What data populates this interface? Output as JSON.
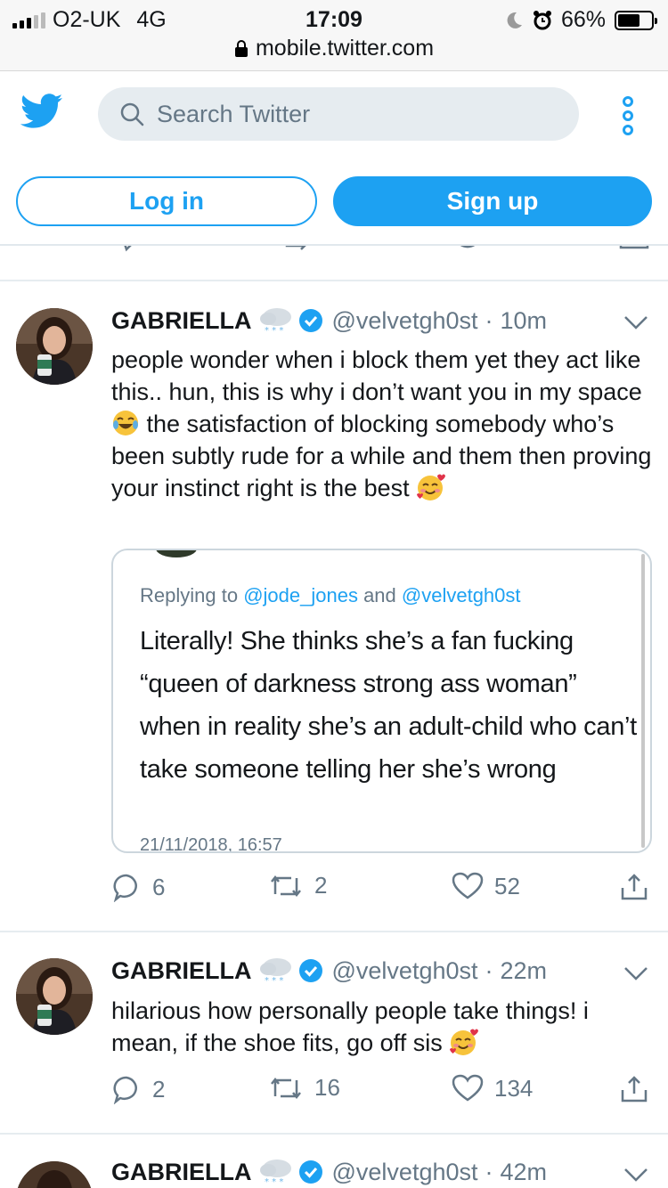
{
  "status_bar": {
    "carrier": "O2-UK",
    "network": "4G",
    "time": "17:09",
    "battery": "66%",
    "battery_level": 0.66,
    "url": "mobile.twitter.com"
  },
  "header": {
    "search_placeholder": "Search Twitter",
    "login_label": "Log in",
    "signup_label": "Sign up"
  },
  "colors": {
    "accent": "#1da1f2",
    "muted": "#657786"
  },
  "tweets": [
    {
      "name": "GABRIELLA",
      "handle": "@velvetgh0st",
      "sep": "·",
      "time": "10m",
      "text_parts": [
        "people wonder when i block them yet they act like this.. hun, this is why i don’t want you in my space ",
        " the satisfaction of blocking somebody who’s been subtly rude for a while and them then proving your instinct right is the best "
      ],
      "quote": {
        "replying_prefix": "Replying to ",
        "replying_user1": "@jode_jones",
        "replying_and": " and ",
        "replying_user2": "@velvetgh0st",
        "text": "Literally! She thinks she’s a fan fucking “queen of darkness strong ass woman” when in reality she’s an adult-child who can’t take someone telling her she’s wrong",
        "date": "21/11/2018, 16:57"
      },
      "replies": "6",
      "retweets": "2",
      "likes": "52"
    },
    {
      "name": "GABRIELLA",
      "handle": "@velvetgh0st",
      "sep": "·",
      "time": "22m",
      "text": "hilarious how personally people take things! i mean, if the shoe fits, go off sis ",
      "replies": "2",
      "retweets": "16",
      "likes": "134"
    },
    {
      "name": "GABRIELLA",
      "handle": "@velvetgh0st",
      "sep": "·",
      "time": "42m"
    }
  ]
}
